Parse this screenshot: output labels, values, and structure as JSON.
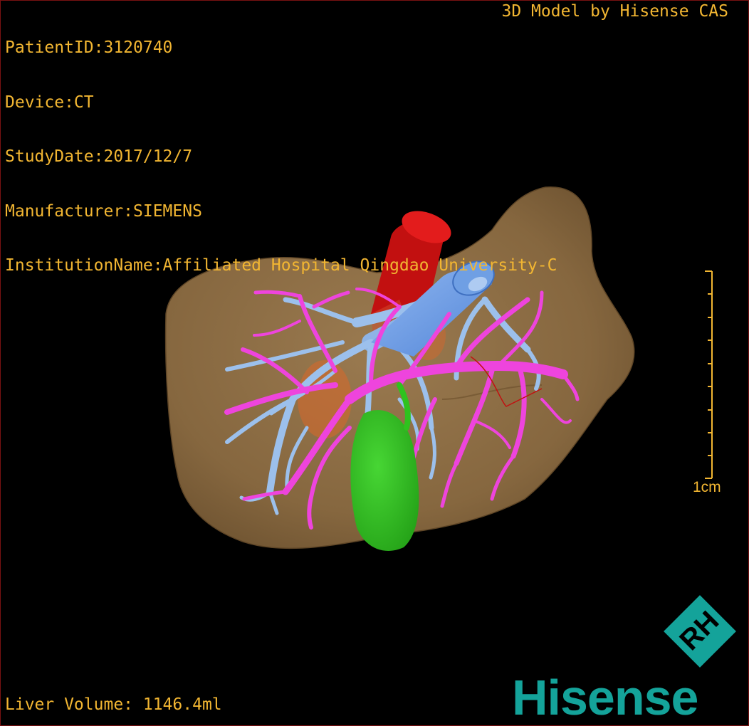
{
  "header": {
    "patient_id": "PatientID:3120740",
    "device": "Device:CT",
    "study_date": "StudyDate:2017/12/7",
    "manufacturer": "Manufacturer:SIEMENS",
    "institution": "InstitutionName:Affiliated Hospital Qingdao University-C",
    "credit": "3D Model by Hisense CAS"
  },
  "footer": {
    "liver_volume": "Liver Volume: 1146.4ml"
  },
  "scale": {
    "label": "1cm"
  },
  "brand": {
    "name": "Hisense",
    "mark": "RH"
  },
  "colors": {
    "text": "#f2b632",
    "liver": "#8a6a42",
    "portal_vein": "#ee44dd",
    "hepatic_vein": "#9cc0ec",
    "vena_cava": "#6f9fe4",
    "aorta": "#d11414",
    "gallbladder": "#2fc21e",
    "brand": "#14a39a",
    "border": "#7a1212"
  }
}
